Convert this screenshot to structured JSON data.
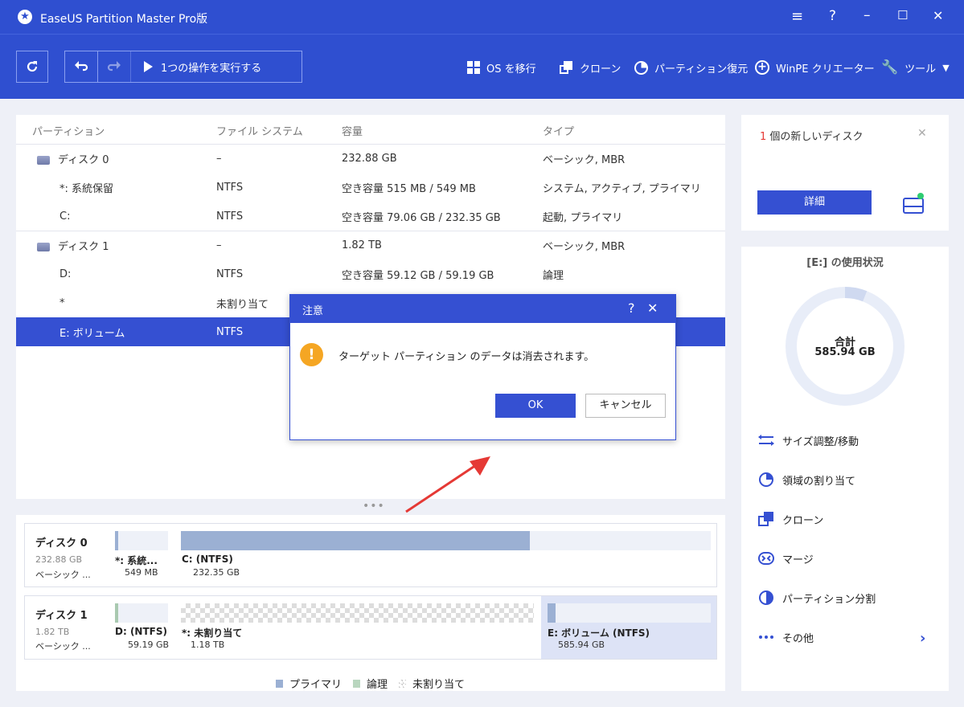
{
  "app": {
    "title": "EaseUS Partition Master Pro版",
    "title_icon": "star-logo-icon"
  },
  "window_controls": {
    "menu": "≡",
    "help": "?",
    "minimize": "–",
    "maximize": "☐",
    "close": "✕"
  },
  "toolbar": {
    "execute_label": "1つの操作を実行する",
    "os_migrate": "OS を移行",
    "clone": "クローン",
    "partition_recovery": "パーティション復元",
    "winpe": "WinPE クリエーター",
    "tools": "ツール"
  },
  "table": {
    "headers": {
      "partition": "パーティション",
      "fs": "ファイル システム",
      "capacity": "容量",
      "type": "タイプ"
    },
    "rows": [
      {
        "name": "ディスク 0",
        "fs": "–",
        "capacity": "232.88 GB",
        "type": "ベーシック, MBR",
        "disk": true
      },
      {
        "name": "*: 系統保留",
        "fs": "NTFS",
        "capacity": "空き容量 515 MB / 549 MB",
        "type": "システム, アクティブ, プライマリ"
      },
      {
        "name": "C:",
        "fs": "NTFS",
        "capacity": "空き容量 79.06 GB / 232.35 GB",
        "type": "起動, プライマリ"
      },
      {
        "name": "ディスク 1",
        "fs": "–",
        "capacity": "1.82 TB",
        "type": "ベーシック, MBR",
        "disk": true
      },
      {
        "name": "D:",
        "fs": "NTFS",
        "capacity": "空き容量 59.12 GB / 59.19 GB",
        "type": "論理"
      },
      {
        "name": "*",
        "fs": "未割り当て",
        "capacity": "",
        "type": ""
      },
      {
        "name": "E: ボリューム",
        "fs": "NTFS",
        "capacity": "",
        "type": "",
        "selected": true
      }
    ]
  },
  "dialog": {
    "title": "注意",
    "help": "?",
    "close": "✕",
    "message": "ターゲット パーティション のデータは消去されます。",
    "ok": "OK",
    "cancel": "キャンセル"
  },
  "new_disk": {
    "count": "1",
    "text": "個の新しいディスク",
    "details": "詳細",
    "close": "✕"
  },
  "usage": {
    "title": "[E:] の使用状況",
    "total_label": "合計",
    "total_value": "585.94 GB",
    "used_fraction": 0.06
  },
  "actions": [
    {
      "label": "サイズ調整/移動",
      "icon": "resize-icon"
    },
    {
      "label": "領域の割り当て",
      "icon": "allocate-pie-icon"
    },
    {
      "label": "クローン",
      "icon": "clone-icon"
    },
    {
      "label": "マージ",
      "icon": "merge-icon"
    },
    {
      "label": "パーティション分割",
      "icon": "split-pie-icon"
    },
    {
      "label": "その他",
      "icon": "more-dots-icon"
    }
  ],
  "disk_map": {
    "disk0": {
      "name": "ディスク 0",
      "size": "232.88 GB",
      "type": "ベーシック ...",
      "p1_label": "*: 系統...",
      "p1_size": "549 MB",
      "p2_label": "C: (NTFS)",
      "p2_size": "232.35 GB"
    },
    "disk1": {
      "name": "ディスク 1",
      "size": "1.82 TB",
      "type": "ベーシック ...",
      "p1_label": "D: (NTFS)",
      "p1_size": "59.19 GB",
      "p2_label": "*: 未割り当て",
      "p2_size": "1.18 TB",
      "p3_label": "E: ボリューム (NTFS)",
      "p3_size": "585.94 GB"
    }
  },
  "legend": {
    "primary": "プライマリ",
    "logical": "論理",
    "unallocated": "未割り当て"
  },
  "colors": {
    "accent": "#2f4fd0",
    "selected": "#3550d2",
    "warning": "#f5a623",
    "bar": "#9bb0d3",
    "red": "#e53935"
  }
}
